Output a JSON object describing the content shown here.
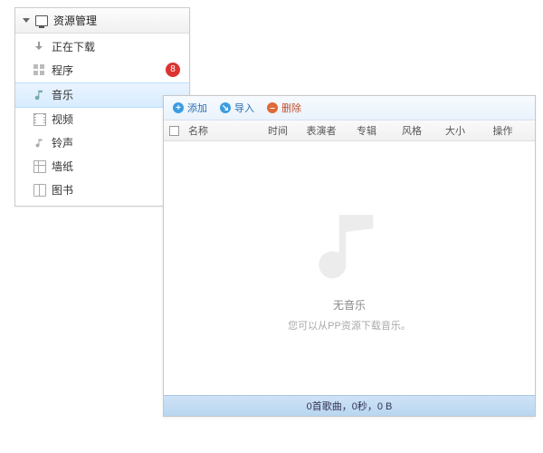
{
  "sidebar": {
    "title": "资源管理",
    "items": [
      {
        "label": "正在下载",
        "icon": "download-icon",
        "selected": false,
        "badge": null
      },
      {
        "label": "程序",
        "icon": "grid-icon",
        "selected": false,
        "badge": "8"
      },
      {
        "label": "音乐",
        "icon": "music-icon",
        "selected": true,
        "badge": null
      },
      {
        "label": "视频",
        "icon": "video-icon",
        "selected": false,
        "badge": null
      },
      {
        "label": "铃声",
        "icon": "ringtone-icon",
        "selected": false,
        "badge": null
      },
      {
        "label": "墙纸",
        "icon": "wallpaper-icon",
        "selected": false,
        "badge": null
      },
      {
        "label": "图书",
        "icon": "book-icon",
        "selected": false,
        "badge": null
      }
    ]
  },
  "toolbar": {
    "add": "添加",
    "import": "导入",
    "delete": "删除"
  },
  "columns": {
    "name": "名称",
    "time": "时间",
    "artist": "表演者",
    "album": "专辑",
    "genre": "风格",
    "size": "大小",
    "op": "操作"
  },
  "empty": {
    "title": "无音乐",
    "sub": "您可以从PP资源下载音乐。"
  },
  "status": "0首歌曲，0秒，0 B"
}
